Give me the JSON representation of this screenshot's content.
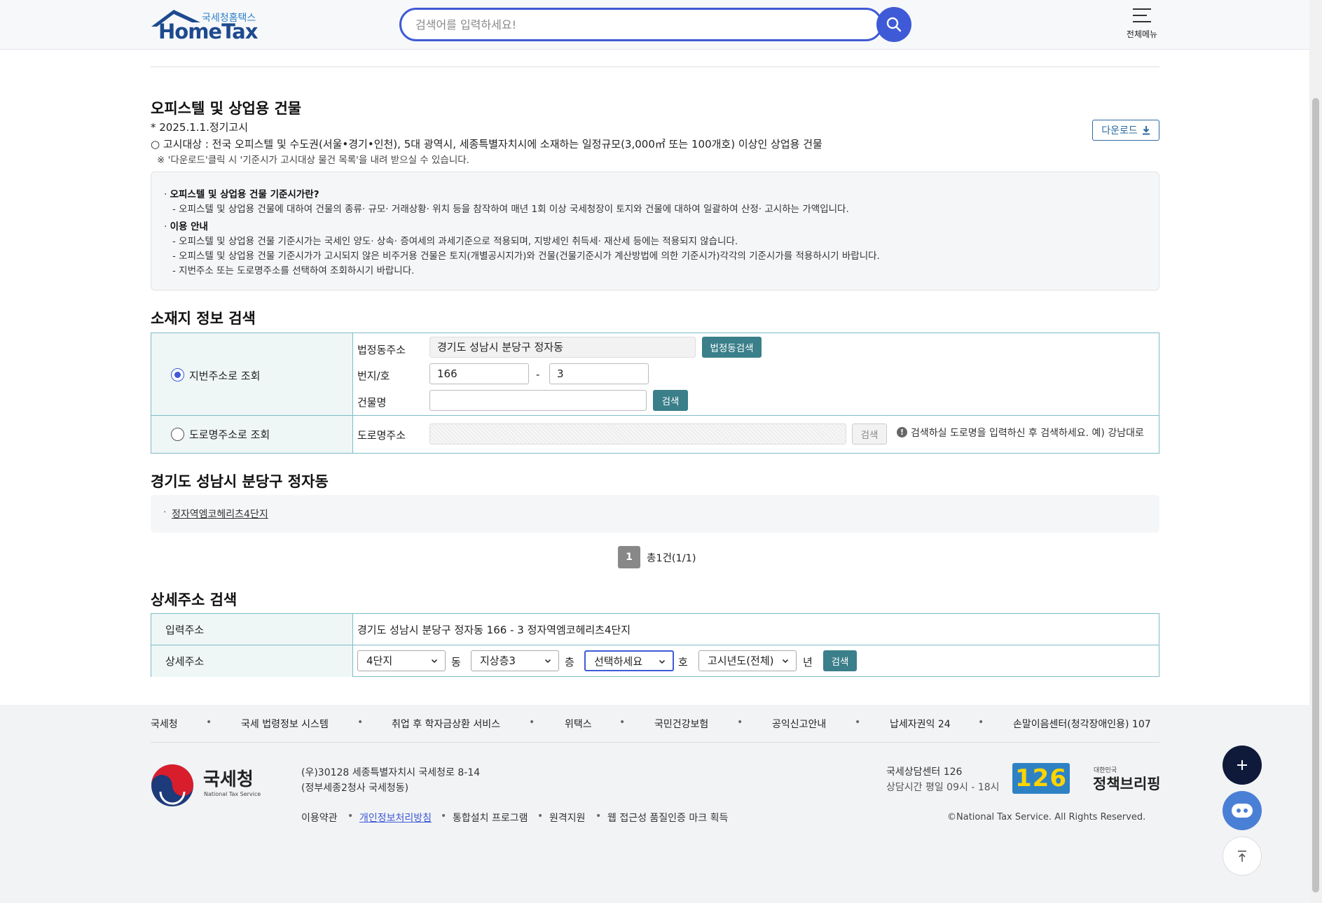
{
  "header": {
    "logo_sub": "국세청홈택스",
    "logo_main": "HomeTax",
    "search_placeholder": "검색어를 입력하세요!",
    "allmenu_label": "전체메뉴"
  },
  "section_office": {
    "title": "오피스텔 및 상업용 건물",
    "notice_date": "* 2025.1.1.정기고시",
    "target": "○ 고시대상 : 전국 오피스텔 및 수도권(서울•경기•인천), 5대 광역시, 세종특별자치시에 소재하는 일정규모(3,000㎡ 또는 100개호) 이상인 상업용 건물",
    "download_note": "※ '다운로드'클릭 시 '기준시가 고시대상 물건 목록'을 내려 받으실 수 있습니다.",
    "download_label": "다운로드"
  },
  "info": {
    "q1_title": "오피스텔 및 상업용 건물 기준시가란?",
    "q1_desc": "- 오피스텔 및 상업용 건물에 대하여 건물의 종류· 규모· 거래상황· 위치 등을 참작하여 매년 1회 이상 국세청장이 토지와 건물에 대하여 일괄하여 산정· 고시하는 가액입니다.",
    "q2_title": "이용 안내",
    "q2_lines": [
      "- 오피스텔 및 상업용 건물 기준시가는 국세인 양도· 상속· 증여세의 과세기준으로 적용되며, 지방세인 취득세· 재산세 등에는 적용되지 않습니다.",
      "- 오피스텔 및 상업용 건물 기준시가가 고시되지 않은 비주거용 건물은 토지(개별공시지가)와 건물(건물기준시가 계산방법에 의한 기준시가)각각의 기준시가를 적용하시기 바랍니다.",
      "- 지번주소 또는 도로명주소를 선택하여 조회하시기 바랍니다."
    ]
  },
  "location_search": {
    "title": "소재지 정보 검색",
    "jibun_radio": "지번주소로 조회",
    "road_radio": "도로명주소로 조회",
    "legal_dong_label": "법정동주소",
    "legal_dong_value": "경기도 성남시 분당구 정자동",
    "legal_dong_btn": "법정동검색",
    "bunji_label": "번지/호",
    "bunji_main": "166",
    "bunji_dash": "-",
    "bunji_sub": "3",
    "building_label": "건물명",
    "building_value": "",
    "search_btn": "검색",
    "road_label": "도로명주소",
    "road_search_btn": "검색",
    "road_hint": "검색하실 도로명을 입력하신 후 검색하세요. 예) 강남대로"
  },
  "result": {
    "title": "경기도 성남시 분당구 정자동",
    "items": [
      "정자역엠코헤리츠4단지"
    ],
    "page": "1",
    "total": "총1건(1/1)"
  },
  "detail_search": {
    "title": "상세주소 검색",
    "input_label": "입력주소",
    "input_value": "경기도 성남시 분당구 정자동 166 - 3 정자역엠코헤리츠4단지",
    "detail_label": "상세주소",
    "dong_value": "4단지",
    "dong_unit": "동",
    "floor_value": "지상층3",
    "floor_unit": "층",
    "ho_value": "선택하세요",
    "ho_unit": "호",
    "year_value": "고시년도(전체)",
    "year_unit": "년",
    "search_btn": "검색"
  },
  "footer": {
    "links": [
      "국세청",
      "국세 법령정보 시스템",
      "취업 후 학자금상환 서비스",
      "위택스",
      "국민건강보험",
      "공익신고안내",
      "납세자권익 24",
      "손말이음센터(청각장애인용) 107"
    ],
    "nts_name": "국세청",
    "nts_eng": "National Tax Service",
    "address1": "(우)30128 세종특별자치시 국세청로 8-14",
    "address2": "(정부세종2청사 국세청동)",
    "bottom_links": [
      "이용약관",
      "개인정보처리방침",
      "통합설치 프로그램",
      "원격지원",
      "웹 접근성 품질인증 마크 획득"
    ],
    "call_center": "국세상담센터 126",
    "call_hours": "상담시간 평일 09시 - 18시",
    "call_number": "126",
    "policy_small": "대한민국",
    "policy_name": "정책브리핑",
    "copyright": "©National Tax Service. All Rights Reserved."
  },
  "colors": {
    "primary": "#3f5ad6",
    "table_border": "#7fbcc8",
    "button_teal": "#3a7f8a",
    "fab_dark": "#0f1a3a"
  }
}
